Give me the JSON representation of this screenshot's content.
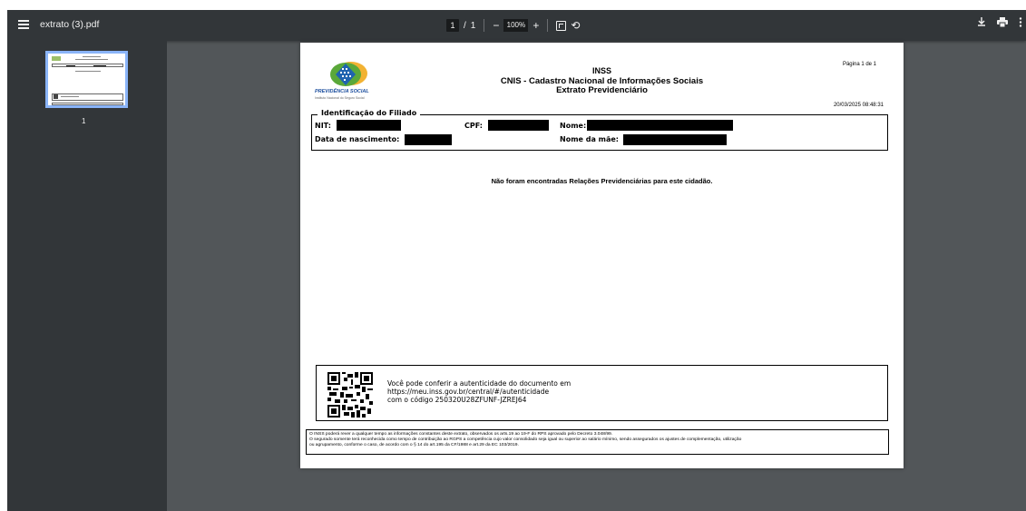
{
  "viewer": {
    "file_title": "extrato (3).pdf",
    "current_page": "1",
    "page_separator": "/",
    "total_pages": "1",
    "zoom_out": "−",
    "zoom_level": "100%",
    "zoom_in": "+",
    "thumbnail_label": "1",
    "icons": [
      "menu-icon",
      "fit-page-icon",
      "rotate-icon",
      "download-icon",
      "print-icon",
      "more-icon"
    ]
  },
  "document": {
    "logo_text": "PREVIDÊNCIA SOCIAL",
    "logo_subtext": "Instituto Nacional do Seguro Social",
    "title": "INSS",
    "subtitle": "CNIS - Cadastro Nacional de Informações Sociais",
    "subtitle2": "Extrato Previdenciário",
    "page_info": "Página 1 de 1",
    "timestamp": "20/03/2025 08:48:31",
    "ident_section": "Identificação do Filiado",
    "fields": {
      "nit": "NIT:",
      "cpf": "CPF:",
      "nome": "Nome:",
      "nascimento": "Data de nascimento:",
      "mae": "Nome da mãe:"
    },
    "notice": "Não foram encontradas Relações Previdenciárias para este cidadão.",
    "auth": {
      "line1": "Você pode conferir a autenticidade do documento em",
      "line2": "https://meu.inss.gov.br/central/#/autenticidade",
      "line3": "com o código 250320U28ZFUNF-JZREJ64"
    },
    "footer": {
      "line1": "O INSS poderá rever a qualquer tempo as informações constantes deste extrato, observados os arts.19 ao 19-F do RPS aprovado pelo Decreto 3.048/99.",
      "line2": "O segurado somente terá reconhecida como tempo de contribuição ao RGPS a competência cujo valor consolidado seja igual ou superior ao salário mínimo, sendo assegurados os ajustes de complementação, utilização",
      "line3": "ou agrupamento, conforme o caso, de acordo com o § 14 do art.195 da CF/1988 e art.29 da EC 103/2019."
    }
  }
}
